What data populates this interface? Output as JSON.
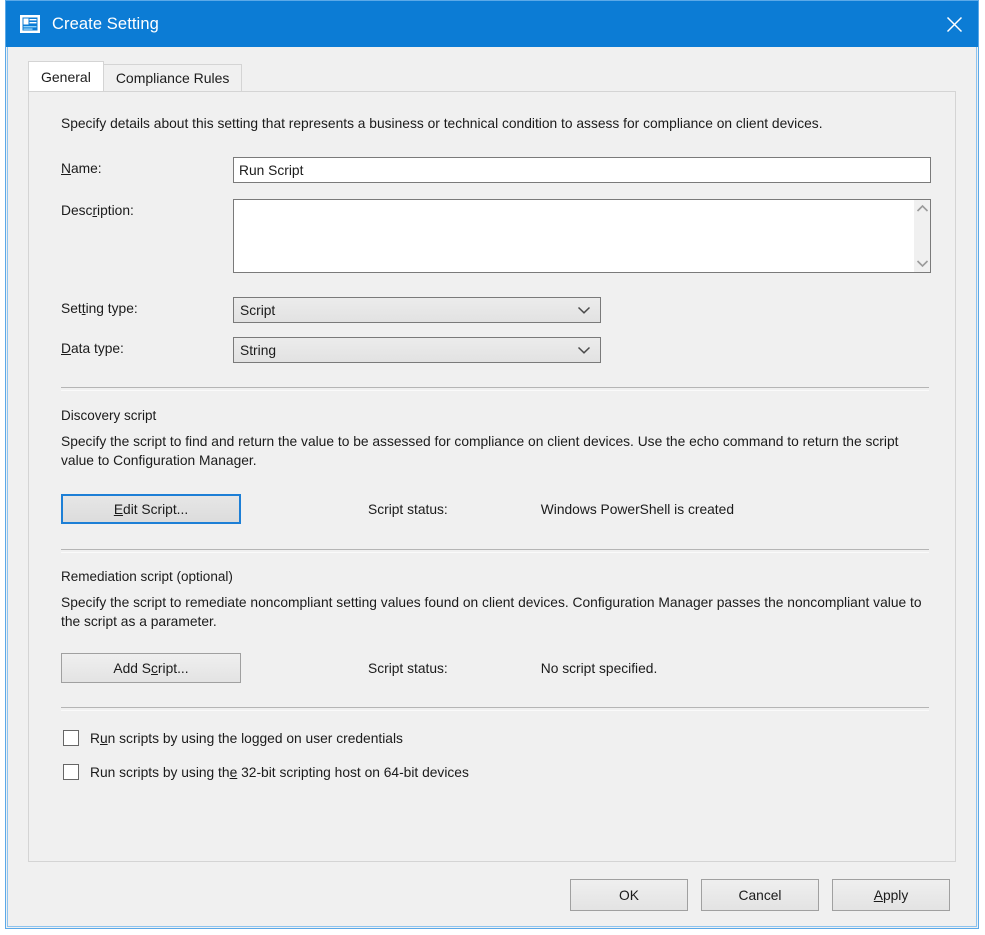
{
  "window": {
    "title": "Create Setting",
    "icon": "setting-document-icon",
    "close_label": "✕",
    "titlebar_color": "#0c7cd5",
    "border_color": "#5ca9e8"
  },
  "tabs": [
    {
      "label": "General",
      "active": true
    },
    {
      "label": "Compliance Rules",
      "active": false
    }
  ],
  "general": {
    "intro": "Specify details about this setting that represents a business or technical condition to assess for compliance on client devices.",
    "name": {
      "label_pre": "",
      "label_acc": "N",
      "label_post": "ame:",
      "value": "Run Script",
      "placeholder": ""
    },
    "description": {
      "label_pre": "Desc",
      "label_acc": "r",
      "label_post": "iption:",
      "value": "",
      "placeholder": "",
      "scroll_up_icon": "chevron-up-icon",
      "scroll_down_icon": "chevron-down-icon"
    },
    "setting_type": {
      "label_pre": "Set",
      "label_acc": "t",
      "label_post": "ing type:",
      "value": "Script",
      "options": [
        "Script"
      ]
    },
    "data_type": {
      "label_pre": "",
      "label_acc": "D",
      "label_post": "ata type:",
      "value": "String",
      "options": [
        "String"
      ]
    },
    "discovery": {
      "title": "Discovery script",
      "description": "Specify the script to find and return the value to be assessed for compliance on client devices. Use the echo command to return the script value to Configuration Manager.",
      "button_pre": "",
      "button_acc": "E",
      "button_post": "dit Script...",
      "status_label": "Script status:",
      "status_value": "Windows PowerShell is created"
    },
    "remediation": {
      "title": "Remediation script (optional)",
      "description": "Specify the script to remediate noncompliant setting values found on client devices. Configuration Manager passes the noncompliant value to the script as a parameter.",
      "button_pre": "Add S",
      "button_acc": "c",
      "button_post": "ript...",
      "status_label": "Script status:",
      "status_value": "No script specified."
    },
    "checkboxes": [
      {
        "label_pre": "R",
        "label_acc": "u",
        "label_post": "n scripts by using the logged on user credentials",
        "checked": false
      },
      {
        "label_pre": "Run scripts by using th",
        "label_acc": "e",
        "label_post": " 32-bit scripting host on 64-bit devices",
        "checked": false
      }
    ]
  },
  "footer": {
    "ok": {
      "pre": "OK",
      "acc": "",
      "post": ""
    },
    "cancel": {
      "pre": "Cancel",
      "acc": "",
      "post": ""
    },
    "apply": {
      "pre": "",
      "acc": "A",
      "post": "pply"
    }
  }
}
